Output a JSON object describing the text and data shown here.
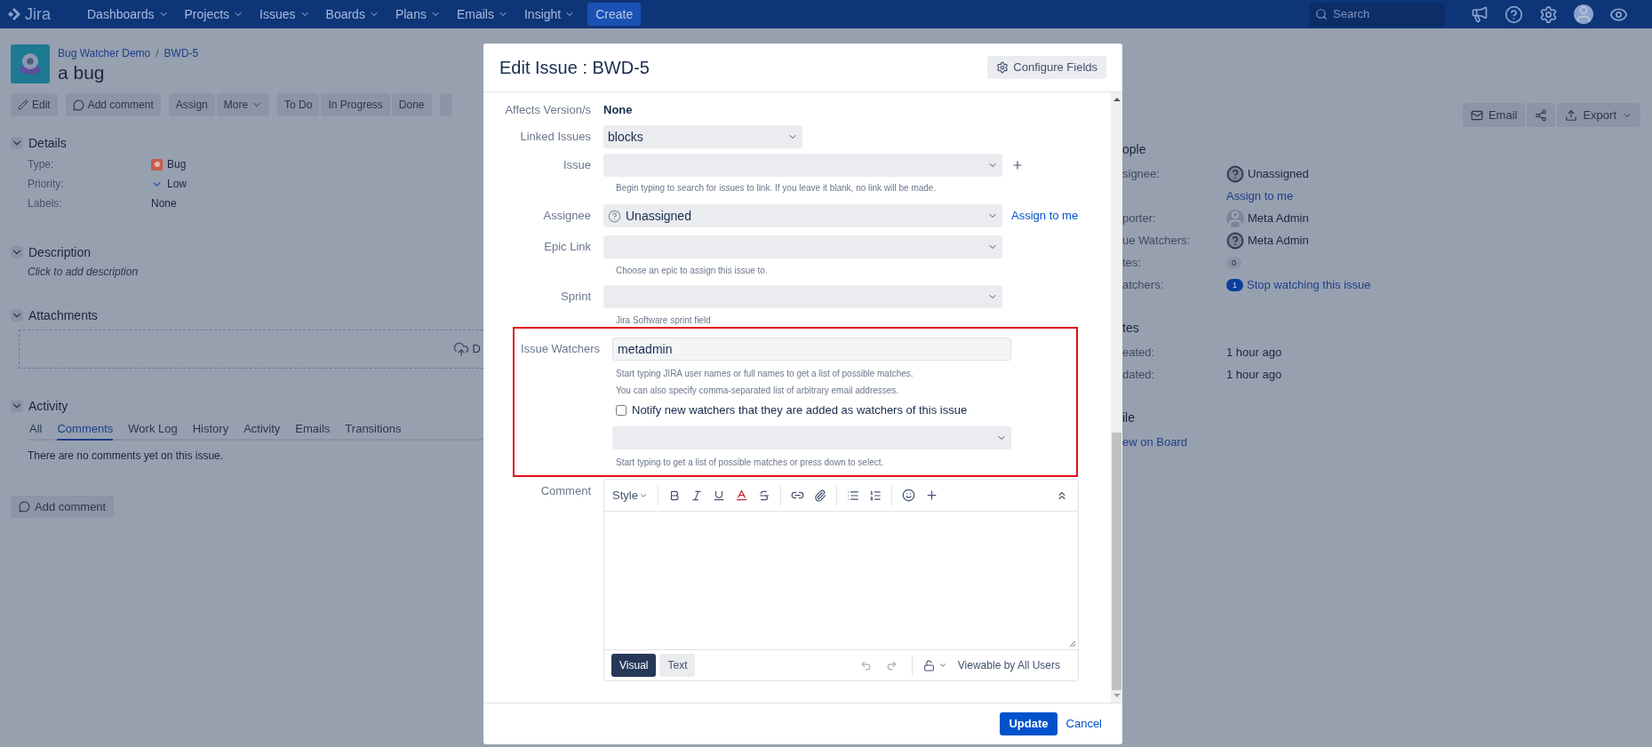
{
  "nav": {
    "logo": "Jira",
    "menus": [
      "Dashboards",
      "Projects",
      "Issues",
      "Boards",
      "Plans",
      "Emails",
      "Insight"
    ],
    "create": "Create",
    "search": {
      "placeholder": "Search"
    }
  },
  "issue": {
    "project": "Bug Watcher Demo",
    "separator": "/",
    "key": "BWD-5",
    "title": "a bug"
  },
  "toolbar": [
    {
      "label": "Edit",
      "kind": "edit"
    },
    {
      "label": "Add comment",
      "kind": "comment"
    },
    {
      "label": "Assign",
      "kind": "plain"
    },
    {
      "label": "More",
      "kind": "dropdown"
    },
    {
      "label": "To Do",
      "kind": "plain"
    },
    {
      "label": "In Progress",
      "kind": "plain"
    },
    {
      "label": "Done",
      "kind": "plain"
    },
    {
      "kind": "edge"
    }
  ],
  "right_toolbar": [
    {
      "label": "Email",
      "kind": "email"
    },
    {
      "kind": "share"
    },
    {
      "label": "Export",
      "kind": "export"
    }
  ],
  "details": {
    "title": "Details",
    "expanded": true,
    "fields": [
      {
        "label": "Type:",
        "value": "Bug",
        "kind": "bug"
      },
      {
        "label": "Priority:",
        "value": "Low",
        "kind": "priority"
      },
      {
        "label": "Labels:",
        "value": "None",
        "kind": "plain"
      }
    ]
  },
  "description": {
    "title": "Description",
    "expanded": true,
    "placeholder": "Click to add description"
  },
  "attachments": {
    "title": "Attachments",
    "expanded": true,
    "drop_text": "D"
  },
  "activity": {
    "title": "Activity",
    "expanded": true,
    "tabs": [
      {
        "label": "All",
        "selected": false
      },
      {
        "label": "Comments",
        "selected": true
      },
      {
        "label": "Work Log",
        "selected": false
      },
      {
        "label": "History",
        "selected": false
      },
      {
        "label": "Activity",
        "selected": false
      },
      {
        "label": "Emails",
        "selected": false
      },
      {
        "label": "Transitions",
        "selected": false
      }
    ],
    "empty": "There are no comments yet on this issue."
  },
  "add_comment": "Add comment",
  "people": {
    "title": "ople",
    "rows": [
      {
        "label": "signee:",
        "value": "Unassigned",
        "kind": "unknown_user"
      },
      {
        "value": "Assign to me",
        "kind": "link"
      },
      {
        "label": "porter:",
        "value": "Meta Admin",
        "kind": "user"
      },
      {
        "label": "ue Watchers:",
        "value": "Meta Admin",
        "kind": "unknown_user"
      },
      {
        "label": "tes:",
        "value": "0",
        "kind": "count"
      },
      {
        "label": "atchers:",
        "count": "1",
        "value": "Stop watching this issue",
        "kind": "watch"
      }
    ]
  },
  "dates": {
    "title": "tes",
    "rows": [
      {
        "label": "eated:",
        "value": "1 hour ago"
      },
      {
        "label": "dated:",
        "value": "1 hour ago"
      }
    ]
  },
  "agile": {
    "title": "ile",
    "link": "ew on Board"
  },
  "modal": {
    "title": "Edit Issue : BWD-5",
    "configure": "Configure Fields",
    "fields": [
      {
        "kind": "static",
        "label": "Affects Version/s",
        "value": "None"
      },
      {
        "kind": "short_select",
        "label": "Linked Issues",
        "value": "blocks"
      },
      {
        "kind": "issue_picker",
        "label": "Issue",
        "help": "Begin typing to search for issues to link. If you leave it blank, no link will be made."
      },
      {
        "kind": "user_select",
        "label": "Assignee",
        "value": "Unassigned",
        "action": "Assign to me"
      },
      {
        "kind": "select",
        "label": "Epic Link",
        "help": "Choose an epic to assign this issue to."
      },
      {
        "kind": "select",
        "label": "Sprint",
        "help": "Jira Software sprint field"
      }
    ],
    "watchers": {
      "label": "Issue Watchers",
      "highlighted": true,
      "value": "metadmin",
      "help": [
        "Start typing JIRA user names or full names to get a list of possible matches.",
        "You can also specify comma-separated list of arbitrary email addresses."
      ],
      "notify": {
        "label": "Notify new watchers that they are added as watchers of this issue",
        "checked": false
      },
      "select_help": "Start typing to get a list of possible matches or press down to select."
    },
    "comment": {
      "label": "Comment",
      "style": "Style",
      "modes": [
        {
          "label": "Visual",
          "selected": true
        },
        {
          "label": "Text",
          "selected": false
        }
      ],
      "visibility": "Viewable by All Users"
    },
    "update": "Update",
    "cancel": "Cancel"
  }
}
